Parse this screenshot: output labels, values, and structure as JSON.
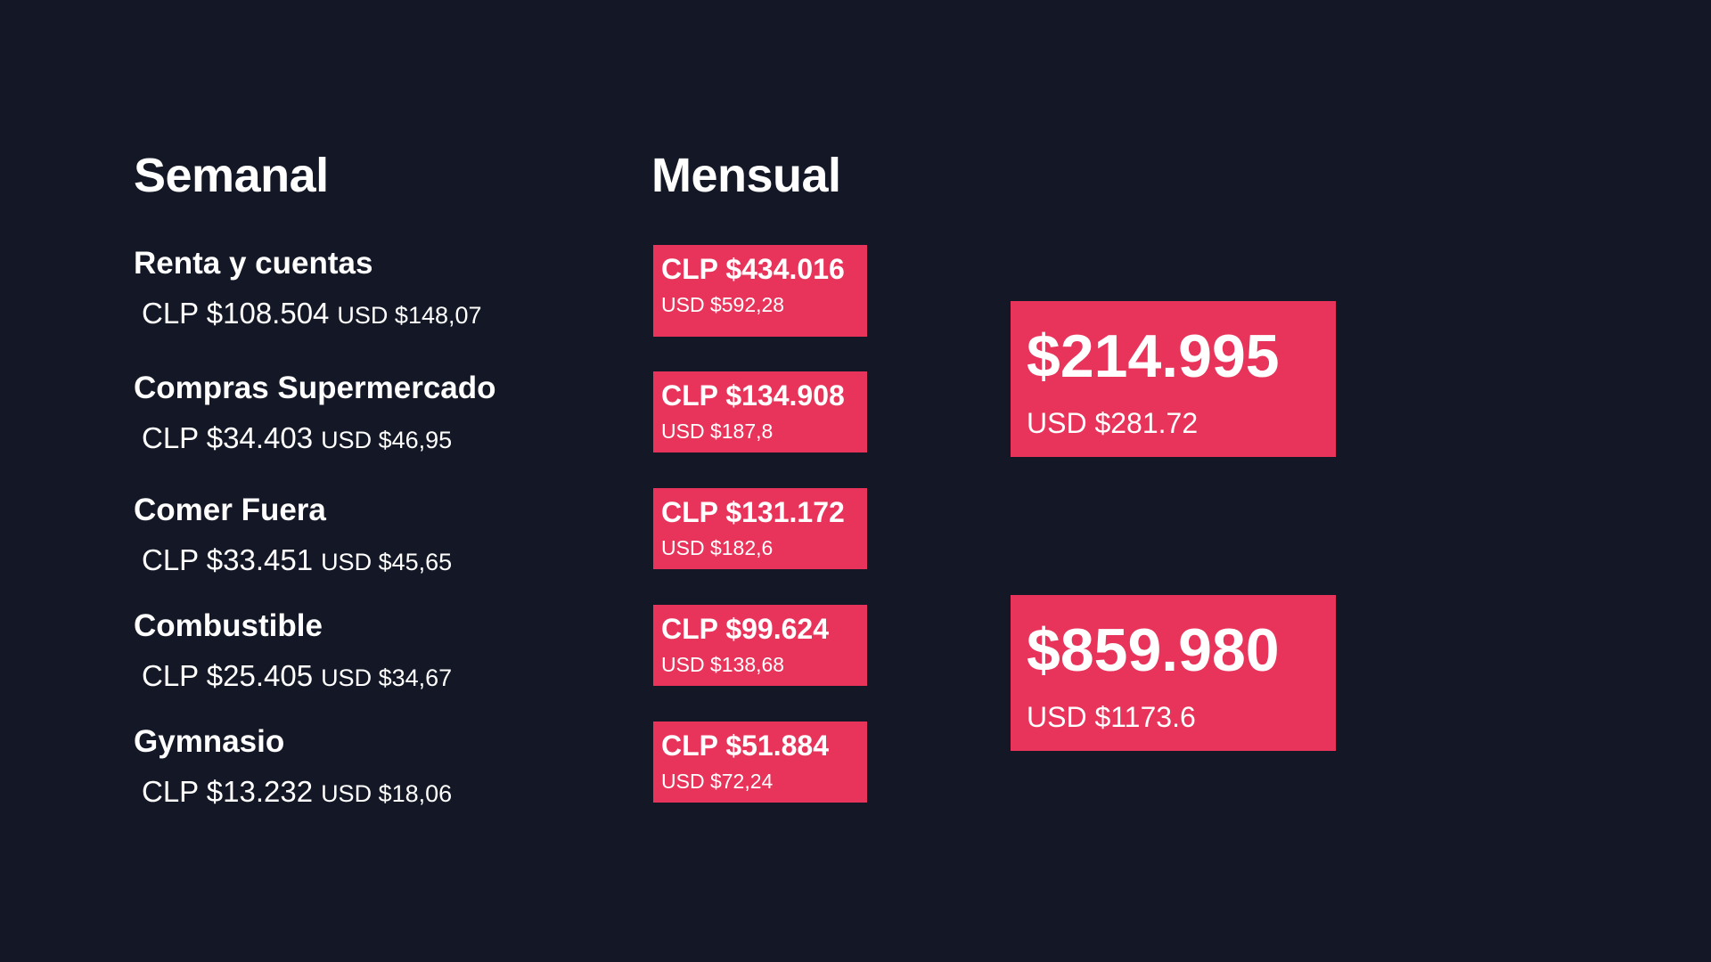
{
  "headings": {
    "weekly": "Semanal",
    "monthly": "Mensual"
  },
  "weekly": [
    {
      "name": "Renta y cuentas",
      "clp": "CLP $108.504",
      "usd": "USD $148,07"
    },
    {
      "name": "Compras Supermercado",
      "clp": "CLP $34.403",
      "usd": "USD $46,95"
    },
    {
      "name": "Comer Fuera",
      "clp": "CLP $33.451",
      "usd": "USD $45,65"
    },
    {
      "name": "Combustible",
      "clp": "CLP $25.405",
      "usd": "USD $34,67"
    },
    {
      "name": "Gymnasio",
      "clp": "CLP $13.232",
      "usd": "USD $18,06"
    }
  ],
  "monthly": [
    {
      "clp": "CLP $434.016",
      "usd": "USD $592,28"
    },
    {
      "clp": "CLP $134.908",
      "usd": "USD $187,8"
    },
    {
      "clp": "CLP $131.172",
      "usd": "USD $182,6"
    },
    {
      "clp": "CLP $99.624",
      "usd": "USD $138,68"
    },
    {
      "clp": "CLP $51.884",
      "usd": "USD $72,24"
    }
  ],
  "totals": {
    "weekly": {
      "amount": "$214.995",
      "usd": "USD $281.72"
    },
    "monthly": {
      "amount": "$859.980",
      "usd": "USD $1173.6"
    }
  },
  "colors": {
    "background": "#141826",
    "accent": "#e8345a",
    "text": "#ffffff"
  }
}
